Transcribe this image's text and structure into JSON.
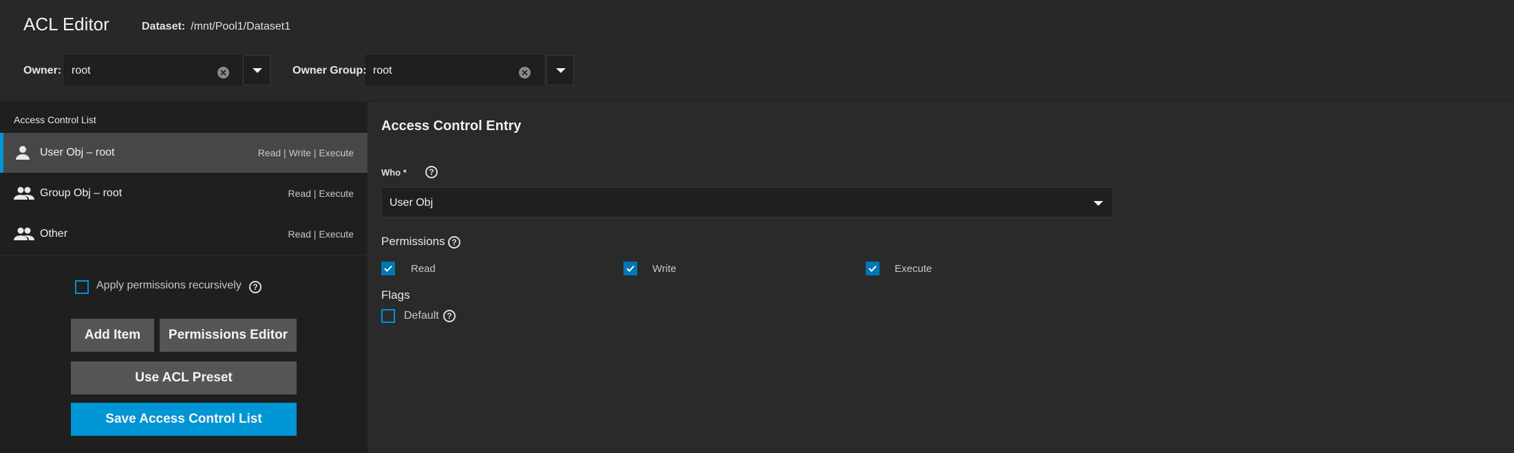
{
  "header": {
    "title": "ACL Editor",
    "dataset_label": "Dataset:",
    "dataset_path": "/mnt/Pool1/Dataset1",
    "owner_label": "Owner:",
    "owner_value": "root",
    "owner_group_label": "Owner Group:",
    "owner_group_value": "root"
  },
  "acl_list": {
    "title": "Access Control List",
    "items": [
      {
        "name": "User Obj – root",
        "permissions": "Read | Write | Execute",
        "icon": "person-icon",
        "selected": true
      },
      {
        "name": "Group Obj – root",
        "permissions": "Read | Execute",
        "icon": "group-icon",
        "selected": false
      },
      {
        "name": "Other",
        "permissions": "Read | Execute",
        "icon": "group-icon",
        "selected": false
      }
    ],
    "apply_recursive_label": "Apply permissions recursively",
    "apply_recursive_checked": false,
    "buttons": {
      "add_item": "Add Item",
      "permissions_editor": "Permissions Editor",
      "use_preset": "Use ACL Preset",
      "save": "Save Access Control List"
    }
  },
  "ace": {
    "title": "Access Control Entry",
    "who_label": "Who *",
    "who_value": "User Obj",
    "permissions_label": "Permissions",
    "permissions": [
      {
        "label": "Read",
        "checked": true
      },
      {
        "label": "Write",
        "checked": true
      },
      {
        "label": "Execute",
        "checked": true
      }
    ],
    "flags_label": "Flags",
    "flags": [
      {
        "label": "Default",
        "checked": false
      }
    ]
  },
  "colors": {
    "accent": "#0095d5",
    "checkbox_fill": "#0078b4",
    "button_gray": "#555555"
  }
}
